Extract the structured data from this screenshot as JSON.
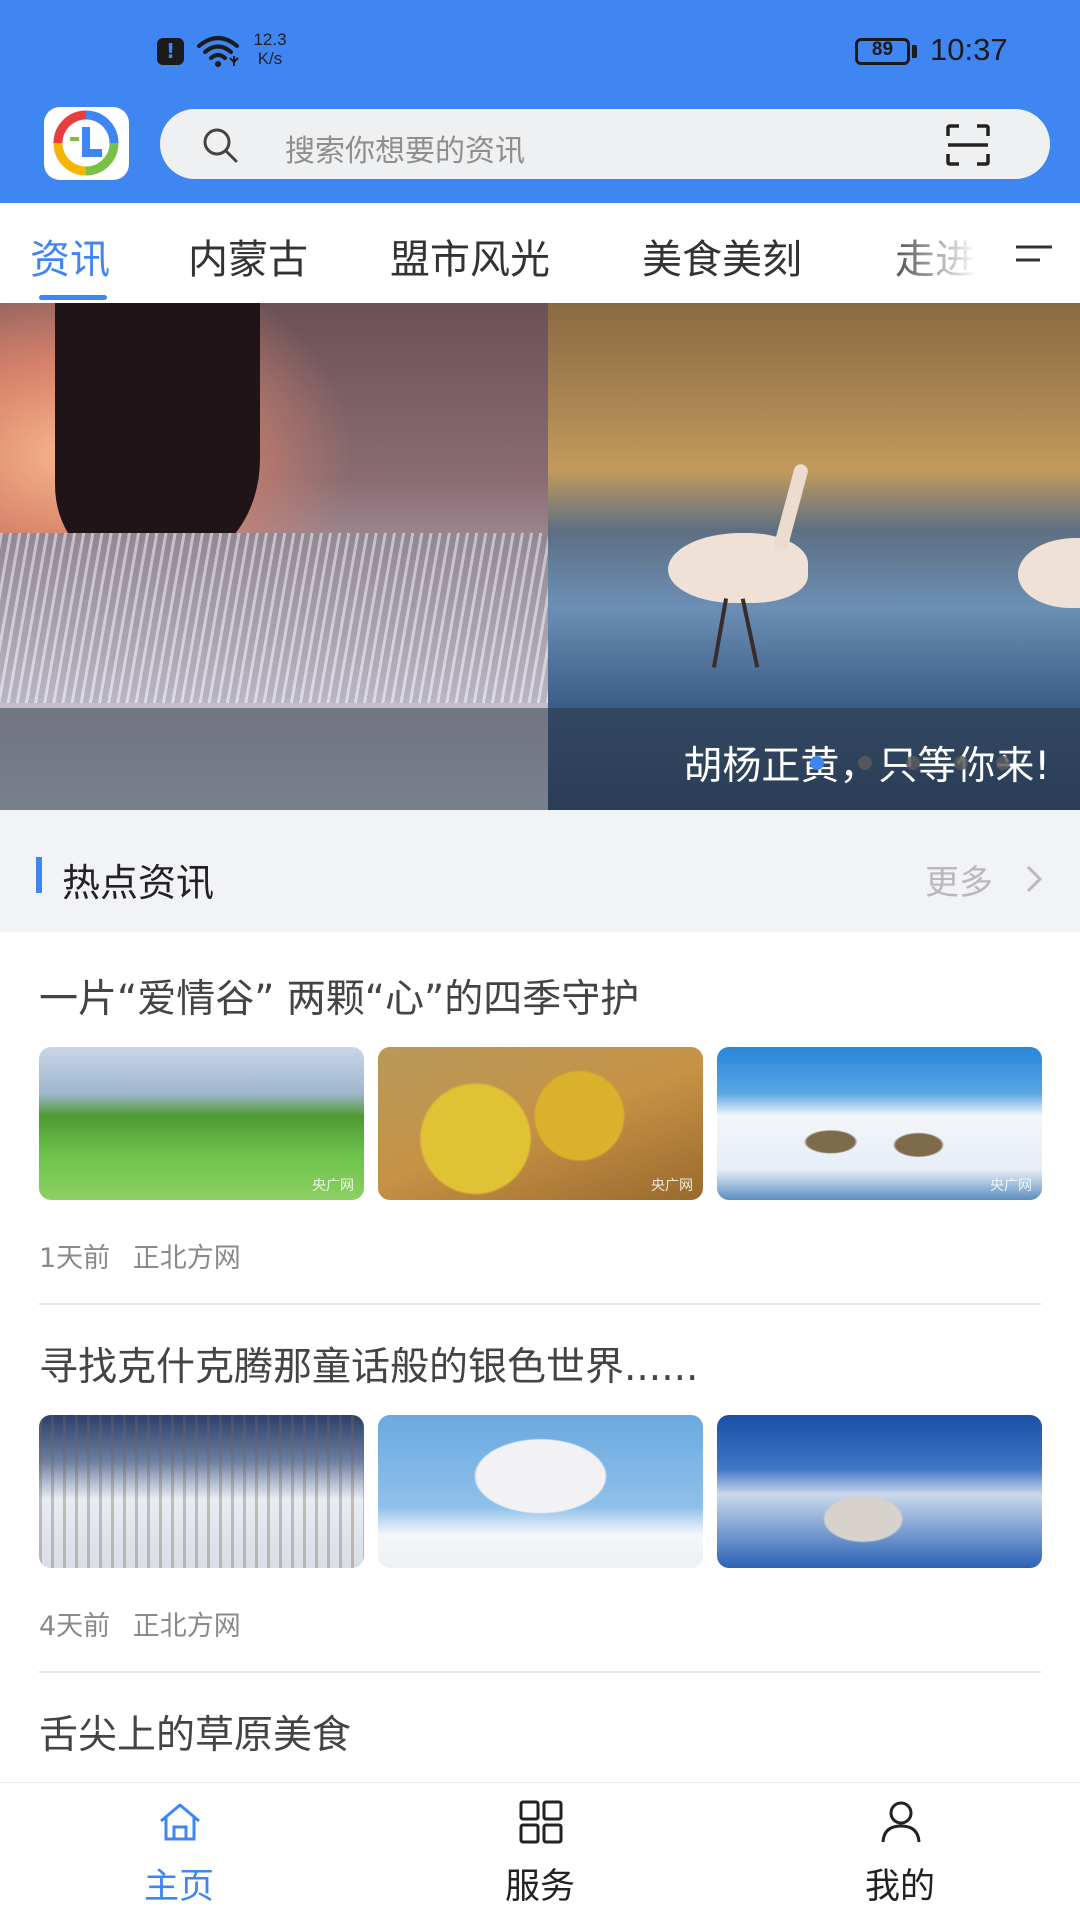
{
  "status_bar": {
    "net_speed_value": "12.3",
    "net_speed_unit": "K/s",
    "battery_level": "89",
    "time": "10:37"
  },
  "search": {
    "placeholder": "搜索你想要的资讯"
  },
  "tabs": [
    {
      "label": "资讯",
      "active": true
    },
    {
      "label": "内蒙古",
      "active": false
    },
    {
      "label": "盟市风光",
      "active": false
    },
    {
      "label": "美食美刻",
      "active": false
    },
    {
      "label": "走进",
      "active": false
    }
  ],
  "banner": {
    "caption": "胡杨正黄，只等你来!",
    "slide_count": 5,
    "active_slide": 1
  },
  "hot_section": {
    "title": "热点资讯",
    "more_label": "更多"
  },
  "news": [
    {
      "title": "一片“爱情谷” 两颗“心”的四季守护",
      "thumb_watermark": "央广网",
      "time_ago": "1天前",
      "source": "正北方网"
    },
    {
      "title": "寻找克什克腾那童话般的银色世界......",
      "time_ago": "4天前",
      "source": "正北方网"
    },
    {
      "title": "舌尖上的草原美食"
    }
  ],
  "bottom_nav": [
    {
      "label": "主页",
      "icon": "home-icon",
      "active": true
    },
    {
      "label": "服务",
      "icon": "grid-icon",
      "active": false
    },
    {
      "label": "我的",
      "icon": "user-icon",
      "active": false
    }
  ],
  "colors": {
    "accent": "#3f86f2",
    "header_bg": "#3f86f2",
    "section_bg": "#f2f3f6"
  }
}
